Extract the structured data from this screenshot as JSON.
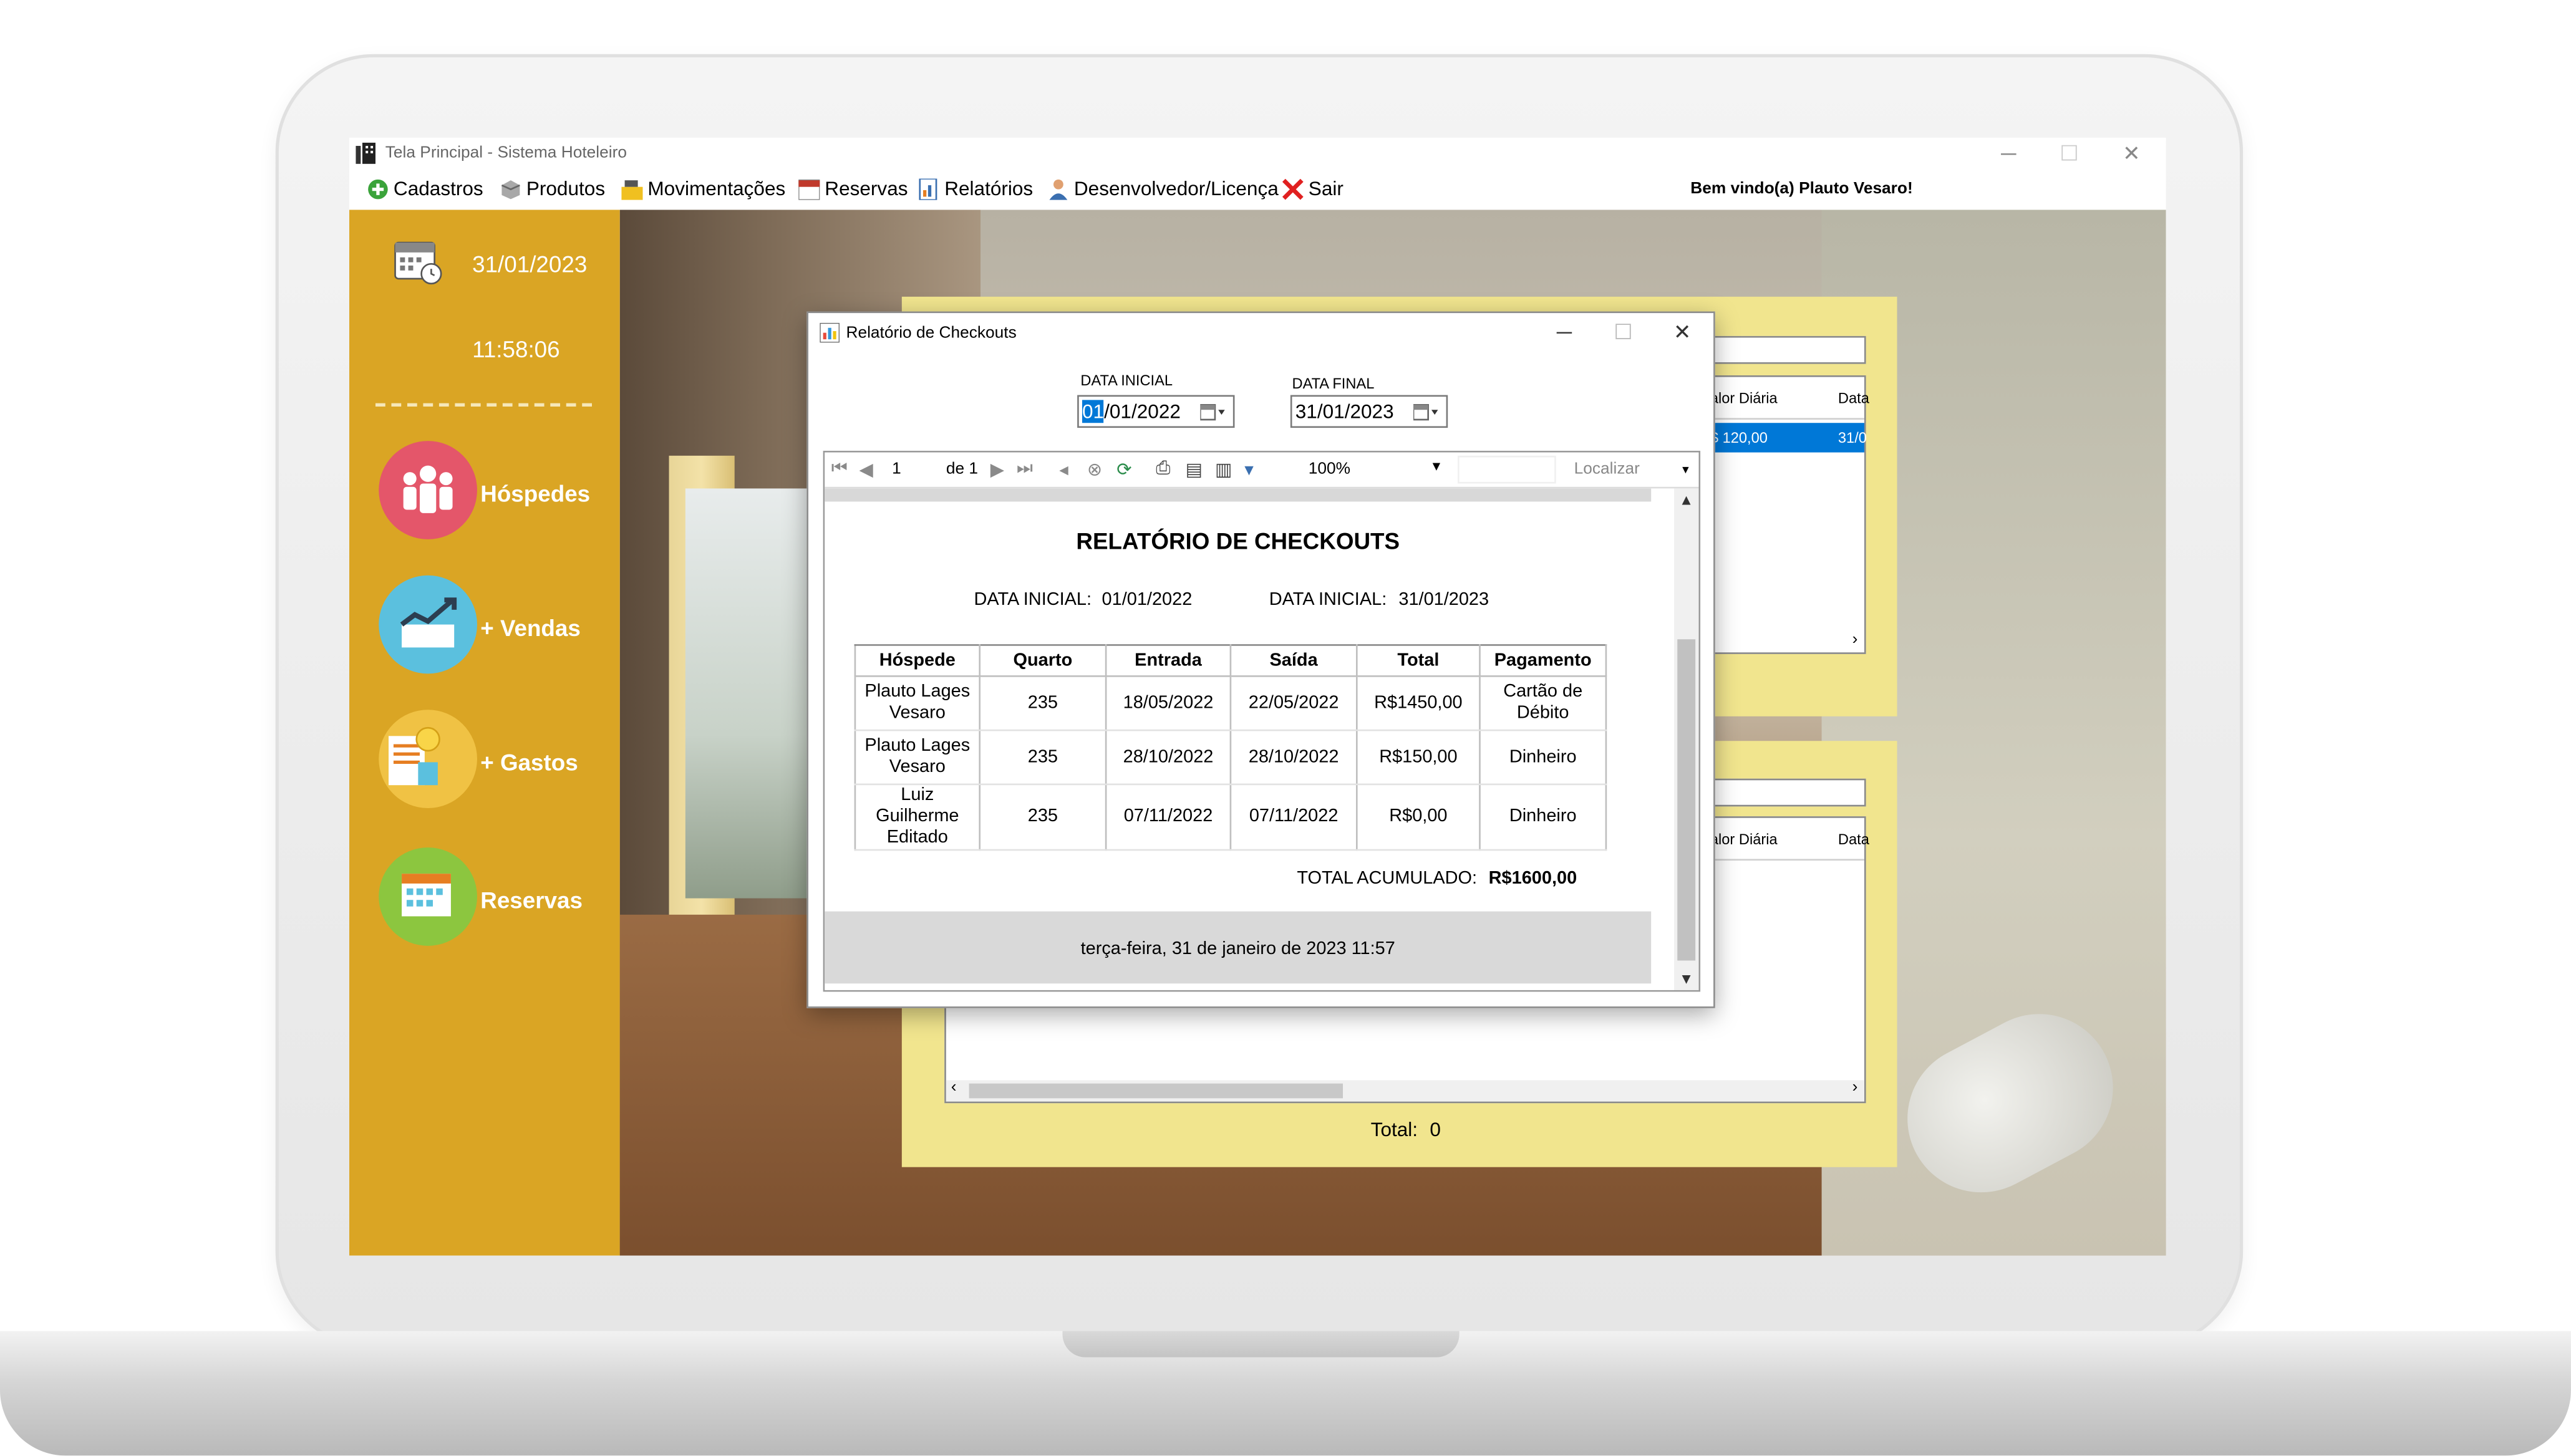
{
  "window": {
    "title": "Tela Principal - Sistema Hoteleiro",
    "welcome": "Bem vindo(a) Plauto Vesaro!"
  },
  "menu": [
    {
      "label": "Cadastros",
      "icon": "plus-circle-icon"
    },
    {
      "label": "Produtos",
      "icon": "box-icon"
    },
    {
      "label": "Movimentações",
      "icon": "cash-register-icon"
    },
    {
      "label": "Reservas",
      "icon": "calendar-icon"
    },
    {
      "label": "Relatórios",
      "icon": "report-icon"
    },
    {
      "label": "Desenvolvedor/Licença",
      "icon": "user-icon"
    },
    {
      "label": "Sair",
      "icon": "close-icon"
    }
  ],
  "sidebar": {
    "date": "31/01/2023",
    "time": "11:58:06",
    "buttons": [
      {
        "label": "Hóspedes",
        "color": "#e4566a"
      },
      {
        "label": "+ Vendas",
        "color": "#5bc0de"
      },
      {
        "label": "+ Gastos",
        "color": "#f0c244"
      },
      {
        "label": "Reservas",
        "color": "#8cc63f"
      }
    ]
  },
  "background": {
    "grid1": {
      "col1": "alor Diária",
      "col2": "Data",
      "row_value": "$ 120,00",
      "row_date": "31/0"
    },
    "grid2": {
      "col1": "alor Diária",
      "col2": "Data"
    },
    "total_label": "Total:",
    "total_value": "0"
  },
  "dialog": {
    "title": "Relatório de Checkouts",
    "data_inicial_label": "DATA INICIAL",
    "data_inicial_selected": "01",
    "data_inicial_rest": "/01/2022",
    "data_final_label": "DATA FINAL",
    "data_final_value": "31/01/2023",
    "toolbar": {
      "page": "1",
      "of_pages": "de 1",
      "zoom": "100%",
      "find": "Localizar"
    },
    "report": {
      "title": "RELATÓRIO DE CHECKOUTS",
      "start_label": "DATA INICIAL:",
      "start_value": "01/01/2022",
      "end_label": "DATA INICIAL:",
      "end_value": "31/01/2023",
      "columns": [
        "Hóspede",
        "Quarto",
        "Entrada",
        "Saída",
        "Total",
        "Pagamento"
      ],
      "rows": [
        [
          "Plauto Lages Vesaro",
          "235",
          "18/05/2022",
          "22/05/2022",
          "R$1450,00",
          "Cartão de Débito"
        ],
        [
          "Plauto Lages Vesaro",
          "235",
          "28/10/2022",
          "28/10/2022",
          "R$150,00",
          "Dinheiro"
        ],
        [
          "Luiz Guilherme Editado",
          "235",
          "07/11/2022",
          "07/11/2022",
          "R$0,00",
          "Dinheiro"
        ]
      ],
      "total_label": "TOTAL ACUMULADO:",
      "total_value": "R$1600,00",
      "footer": "terça-feira, 31 de janeiro de 2023 11:57"
    }
  }
}
